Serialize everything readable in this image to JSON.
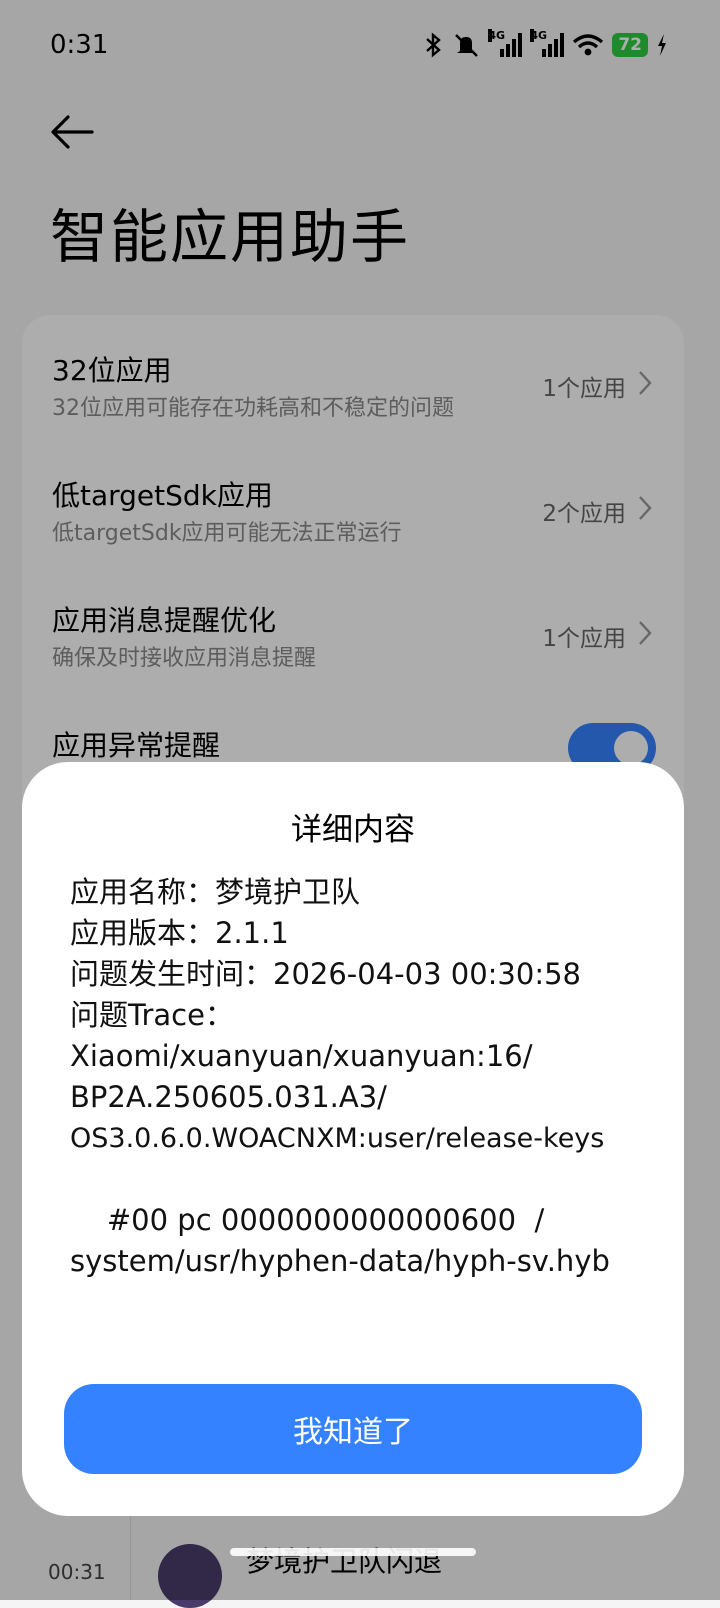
{
  "status_bar": {
    "time": "0:31",
    "signal_tags": [
      "4G",
      "4G"
    ],
    "battery": "72",
    "icons": [
      "bluetooth-icon",
      "mute-icon",
      "signal-icon",
      "signal-icon",
      "wifi-icon",
      "battery-icon",
      "charging-icon"
    ]
  },
  "header": {
    "title": "智能应用助手"
  },
  "settings": {
    "items": [
      {
        "title": "32位应用",
        "subtitle": "32位应用可能存在功耗高和不稳定的问题",
        "value": "1个应用"
      },
      {
        "title": "低targetSdk应用",
        "subtitle": "低targetSdk应用可能无法正常运行",
        "value": "2个应用"
      },
      {
        "title": "应用消息提醒优化",
        "subtitle": "确保及时接收应用消息提醒",
        "value": "1个应用"
      },
      {
        "title": "应用异常提醒",
        "toggle_on": true
      }
    ]
  },
  "background_list": {
    "item_time": "00:31",
    "item_text": "梦境护卫队闪退"
  },
  "dialog": {
    "title": "详细内容",
    "lines": [
      "应用名称：梦境护卫队",
      "应用版本：2.1.1",
      "问题发生时间：2026-04-03 00:30:58",
      "问题Trace：",
      "Xiaomi/xuanyuan/xuanyuan:16/",
      "BP2A.250605.031.A3/",
      "OS3.0.6.0.WOACNXM:user/release-keys",
      "",
      "    #00 pc 0000000000000600  /",
      "system/usr/hyphen-data/hyph-sv.hyb"
    ],
    "confirm_label": "我知道了"
  },
  "colors": {
    "accent": "#3482ff",
    "battery": "#2ecc40"
  }
}
